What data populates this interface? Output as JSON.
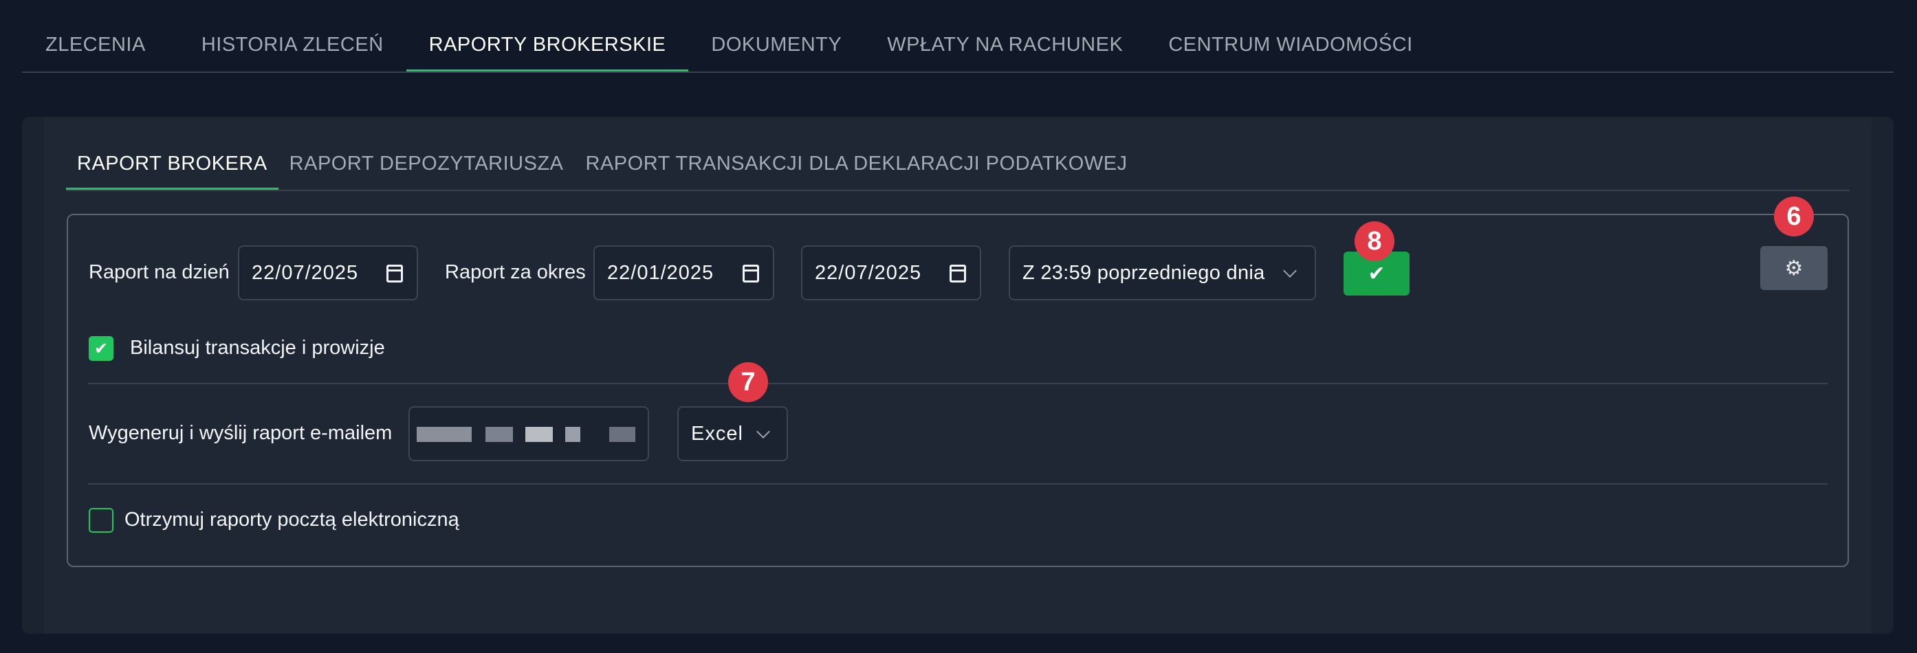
{
  "top_tabs": [
    {
      "label": "ZLECENIA"
    },
    {
      "label": "HISTORIA ZLECEŃ"
    },
    {
      "label": "RAPORTY BROKERSKIE",
      "active": true
    },
    {
      "label": "DOKUMENTY"
    },
    {
      "label": "WPŁATY NA RACHUNEK"
    },
    {
      "label": "CENTRUM WIADOMOŚCI"
    }
  ],
  "sub_tabs": [
    {
      "label": "RAPORT BROKERA",
      "active": true
    },
    {
      "label": "RAPORT DEPOZYTARIUSZA"
    },
    {
      "label": "RAPORT TRANSAKCJI DLA DEKLARACJI PODATKOWEJ"
    }
  ],
  "form": {
    "report_date_label": "Raport na dzień",
    "report_date_value": "22/07/2025",
    "period_label": "Raport za okres",
    "period_from": "22/01/2025",
    "period_to": "22/07/2025",
    "time_select_value": "Z 23:59 poprzedniego dnia",
    "balance_checkbox_label": "Bilansuj transakcje i prowizje",
    "balance_checked": true,
    "email_label": "Wygeneruj i wyślij raport e-mailem",
    "format_select_value": "Excel",
    "receive_email_label": "Otrzymuj raporty pocztą elektroniczną",
    "receive_email_checked": false
  },
  "badges": {
    "settings": "6",
    "format": "7",
    "confirm": "8"
  },
  "icons": {
    "confirm": "check-icon",
    "settings": "gears-icon",
    "calendar": "calendar-icon",
    "select": "chevron-down-icon"
  },
  "colors": {
    "accent": "#22c55e",
    "badge": "#e23946",
    "background": "#111827"
  }
}
